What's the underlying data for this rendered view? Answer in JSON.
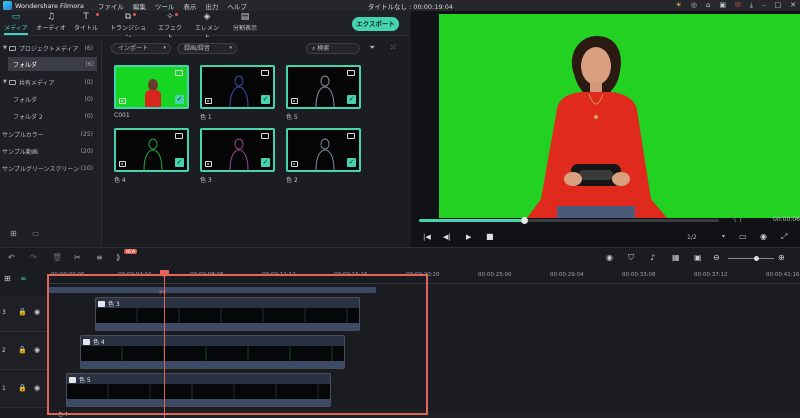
{
  "app": {
    "name": "Wondershare Filmora",
    "project_title": "タイトルなし : 00:00:19:04"
  },
  "menu": [
    "ファイル",
    "編集",
    "ツール",
    "表示",
    "出力",
    "ヘルプ"
  ],
  "toolbar": {
    "tools": [
      {
        "label": "メディア",
        "icon": "folder-icon",
        "active": true,
        "dot": false
      },
      {
        "label": "オーディオ",
        "icon": "music-icon",
        "active": false,
        "dot": false
      },
      {
        "label": "タイトル",
        "icon": "text-icon",
        "active": false,
        "dot": true
      },
      {
        "label": "トランジション",
        "icon": "transition-icon",
        "active": false,
        "dot": true
      },
      {
        "label": "エフェクト",
        "icon": "effect-icon",
        "active": false,
        "dot": true
      },
      {
        "label": "エレメント",
        "icon": "element-icon",
        "active": false,
        "dot": false
      },
      {
        "label": "分割表示",
        "icon": "split-screen-icon",
        "active": false,
        "dot": false
      }
    ],
    "export_label": "エクスポート"
  },
  "sidebar": {
    "items": [
      {
        "label": "プロジェクトメディア",
        "count": "(6)"
      },
      {
        "label": "フォルダ",
        "count": "(6)"
      },
      {
        "label": "共有メディア",
        "count": "(0)"
      },
      {
        "label": "フォルダ",
        "count": "(0)"
      },
      {
        "label": "フォルダ 2",
        "count": "(0)"
      },
      {
        "label": "サンプルカラー",
        "count": "(25)"
      },
      {
        "label": "サンプル動画",
        "count": "(20)"
      },
      {
        "label": "サンプルグリーンスクリーン",
        "count": "(10)"
      }
    ]
  },
  "media": {
    "import_label": "インポート",
    "record_label": "録画/録音",
    "search_placeholder": "検索",
    "items": [
      {
        "label": "C001"
      },
      {
        "label": "色 1"
      },
      {
        "label": "色 5"
      },
      {
        "label": "色 4"
      },
      {
        "label": "色 3"
      },
      {
        "label": "色 2"
      }
    ]
  },
  "player": {
    "progress": 0.35,
    "timecode": "00:00:06",
    "quality": "1/2"
  },
  "timeline": {
    "ruler": [
      "00:00:00:00",
      "00:00:04:04",
      "00:00:08:08",
      "00:00:12:12",
      "00:00:16:16",
      "00:00:20:20",
      "00:00:25:00",
      "00:00:29:04",
      "00:00:33:08",
      "00:00:37:12",
      "00:00:41:16"
    ],
    "tracks": [
      {
        "num": "3",
        "clip": "色 3"
      },
      {
        "num": "2",
        "clip": "色 4"
      },
      {
        "num": "1",
        "clip": "色 5"
      }
    ],
    "partial_clip": "色 4",
    "badge": "NEW"
  },
  "colors": {
    "accent": "#47d3b0",
    "green_screen": "#22d122",
    "highlight": "#e0665a"
  }
}
